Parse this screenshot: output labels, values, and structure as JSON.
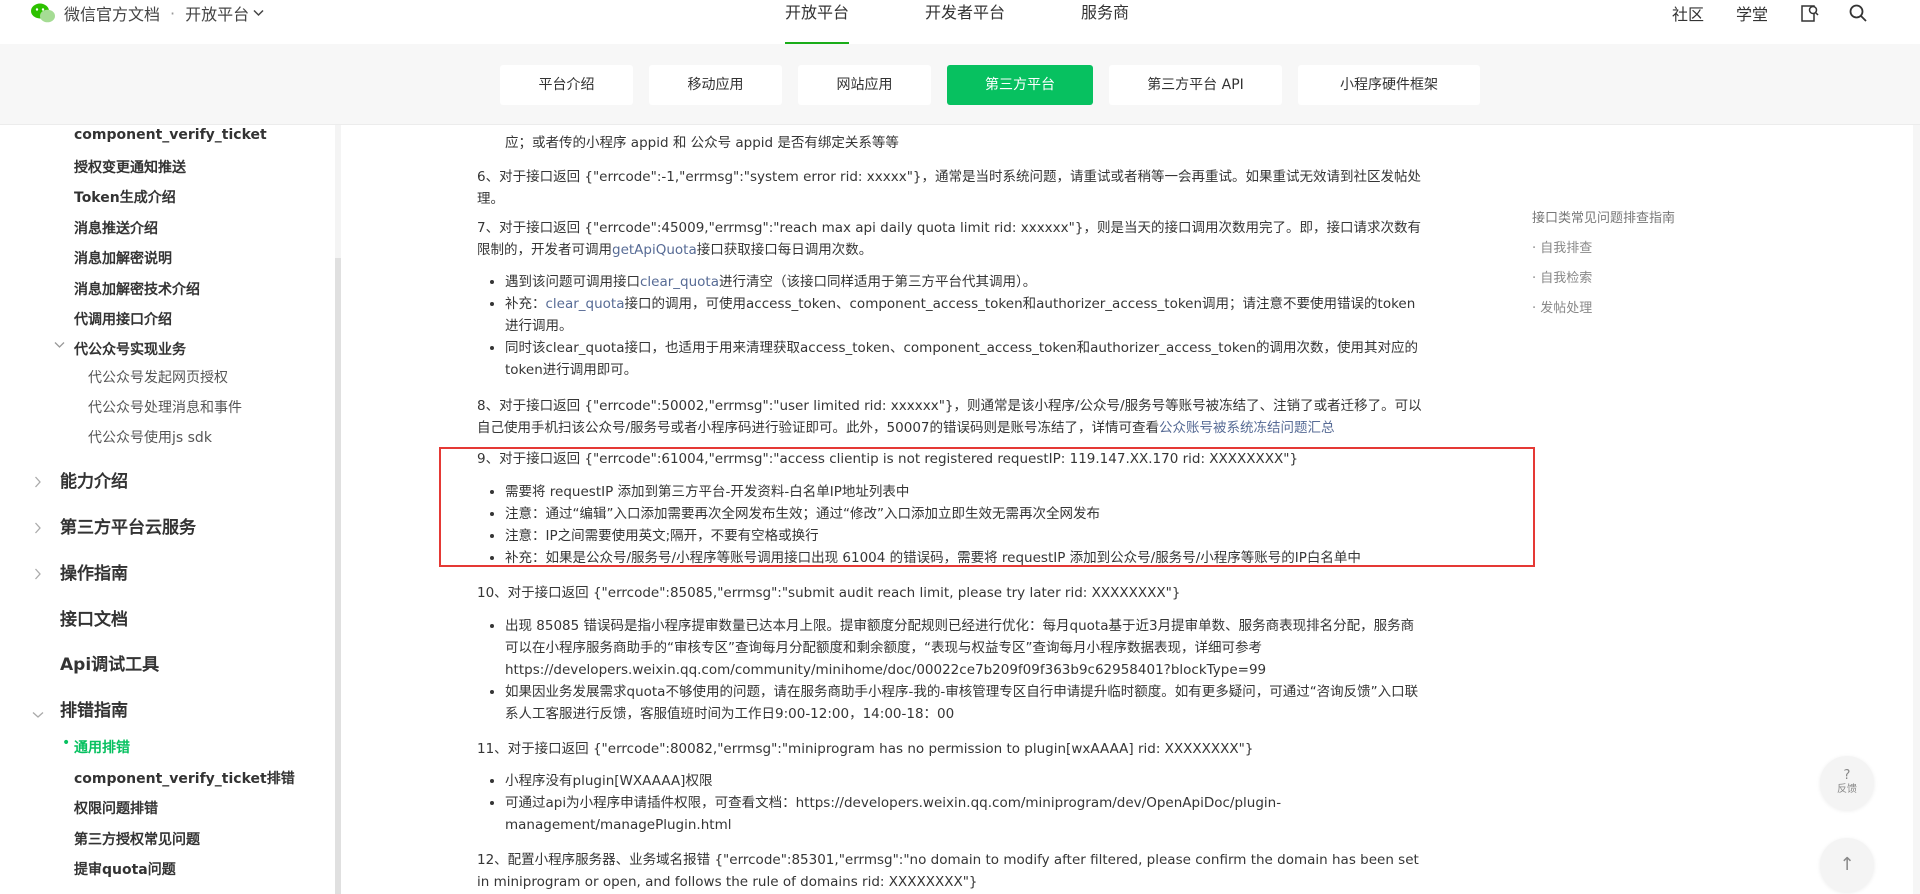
{
  "header": {
    "brand": "微信官方文档",
    "separator": "·",
    "platform_menu": "开放平台",
    "nav": [
      "开放平台",
      "开发者平台",
      "服务商"
    ],
    "right": [
      "社区",
      "学堂"
    ]
  },
  "subnav": {
    "tabs": [
      "平台介绍",
      "移动应用",
      "网站应用",
      "第三方平台",
      "第三方平台 API",
      "小程序硬件框架"
    ],
    "active": "第三方平台"
  },
  "sidebar": {
    "level2_top": [
      "component_verify_ticket",
      "授权变更通知推送",
      "Token生成介绍",
      "消息推送介绍",
      "消息加解密说明",
      "消息加解密技术介绍",
      "代调用接口介绍"
    ],
    "group_title": "代公众号实现业务",
    "group_items": [
      "代公众号发起网页授权",
      "代公众号处理消息和事件",
      "代公众号使用js sdk"
    ],
    "level1": [
      "能力介绍",
      "第三方平台云服务",
      "操作指南",
      "接口文档",
      "Api调试工具",
      "排错指南"
    ],
    "troubleshoot_items": [
      "通用排错",
      "component_verify_ticket排错",
      "权限问题排错",
      "第三方授权常见问题",
      "提审quota问题"
    ],
    "active_item": "通用排错"
  },
  "content": {
    "p5_tail": "应；或者传的小程序 appid 和 公众号 appid 是否有绑定关系等等",
    "p6": "6、对于接口返回 {\"errcode\":-1,\"errmsg\":\"system error rid: xxxxx\"}，通常是当时系统问题，请重试或者稍等一会再重试。如果重试无效请到社区发帖处理。",
    "p7_a": "7、对于接口返回 {\"errcode\":45009,\"errmsg\":\"reach max api daily quota limit rid: xxxxxx\"}，则是当天的接口调用次数用完了。即，接口请求次数有限制的，开发者可调用",
    "p7_link": "getApiQuota",
    "p7_b": "接口获取接口每日调用次数。",
    "p7_li1_a": "遇到该问题可调用接口",
    "p7_li1_link": "clear_quota",
    "p7_li1_b": "进行清空（该接口同样适用于第三方平台代其调用）。",
    "p7_li2_a": "补充：",
    "p7_li2_link": "clear_quota",
    "p7_li2_b": "接口的调用，可使用access_token、component_access_token和authorizer_access_token调用；请注意不要使用错误的token进行调用。",
    "p7_li3": "同时该clear_quota接口，也适用于用来清理获取access_token、component_access_token和authorizer_access_token的调用次数，使用其对应的token进行调用即可。",
    "p8_a": "8、对于接口返回 {\"errcode\":50002,\"errmsg\":\"user limited rid: xxxxxx\"}，则通常是该小程序/公众号/服务号等账号被冻结了、注销了或者迁移了。可以自己使用手机扫该公众号/服务号或者小程序码进行验证即可。此外，50007的错误码则是账号冻结了，详情可查看",
    "p8_link": "公众账号被系统冻结问题汇总",
    "p9": "9、对于接口返回 {\"errcode\":61004,\"errmsg\":\"access clientip is not registered requestIP: 119.147.XX.170 rid: XXXXXXXX\"}",
    "p9_items": [
      "需要将 requestIP 添加到第三方平台-开发资料-白名单IP地址列表中",
      "注意：通过“编辑”入口添加需要再次全网发布生效；通过“修改”入口添加立即生效无需再次全网发布",
      "注意：IP之间需要使用英文;隔开，不要有空格或换行",
      "补充：如果是公众号/服务号/小程序等账号调用接口出现 61004 的错误码，需要将 requestIP 添加到公众号/服务号/小程序等账号的IP白名单中"
    ],
    "p10": "10、对于接口返回 {\"errcode\":85085,\"errmsg\":\"submit audit reach limit, please try later rid: XXXXXXXX\"}",
    "p10_items": [
      "出现 85085 错误码是指小程序提审数量已达本月上限。提审额度分配规则已经进行优化：每月quota基于近3月提审单数、服务商表现排名分配，服务商可以在小程序服务商助手的“审核专区”查询每月分配额度和剩余额度，“表现与权益专区”查询每月小程序数据表现，详细可参考https://developers.weixin.qq.com/community/minihome/doc/00022ce7b209f09f363b9c62958401?blockType=99",
      "如果因业务发展需求quota不够使用的问题，请在服务商助手小程序-我的-审核管理专区自行申请提升临时额度。如有更多疑问，可通过“咨询反馈”入口联系人工客服进行反馈，客服值班时间为工作日9:00-12:00，14:00-18：00"
    ],
    "p11": "11、对于接口返回 {\"errcode\":80082,\"errmsg\":\"miniprogram has no permission to plugin[wxAAAA] rid: XXXXXXXX\"}",
    "p11_items": [
      "小程序没有plugin[WXAAAA]权限",
      "可通过api为小程序申请插件权限，可查看文档：https://developers.weixin.qq.com/miniprogram/dev/OpenApiDoc/plugin-management/managePlugin.html"
    ],
    "p12": "12、配置小程序服务器、业务域名报错 {\"errcode\":85301,\"errmsg\":\"no domain to modify after filtered, please confirm the domain has been set in miniprogram or open, and follows the rule of domains rid: XXXXXXXX\"}"
  },
  "toc": {
    "title": "接口类常见问题排查指南",
    "items": [
      "· 自我排查",
      "· 自我检索",
      "· 发帖处理"
    ]
  },
  "floating": {
    "feedback_symbol": "?",
    "feedback_label": "反馈",
    "top_symbol": "↑"
  },
  "colors": {
    "accent": "#07c160",
    "link": "#576b95",
    "highlight_border": "#e53935"
  }
}
